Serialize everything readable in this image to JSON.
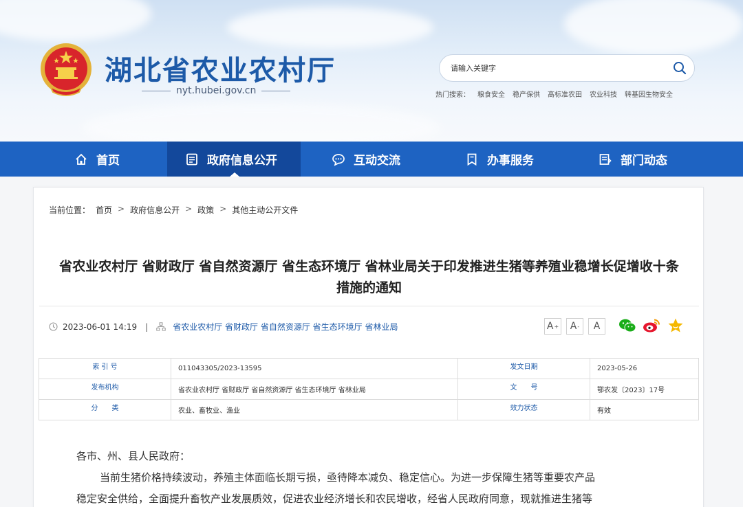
{
  "header": {
    "site_title": "湖北省农业农村厅",
    "site_domain": "nyt.hubei.gov.cn",
    "search": {
      "placeholder": "请输入关键字"
    },
    "hot_label": "热门搜索：",
    "hot_links": [
      "粮食安全",
      "稳产保供",
      "高标准农田",
      "农业科技",
      "转基因生物安全"
    ]
  },
  "nav": {
    "items": [
      {
        "label": "首页",
        "icon": "home-icon"
      },
      {
        "label": "政府信息公开",
        "icon": "document-icon",
        "active": true
      },
      {
        "label": "互动交流",
        "icon": "chat-icon"
      },
      {
        "label": "办事服务",
        "icon": "bookmark-icon"
      },
      {
        "label": "部门动态",
        "icon": "news-icon"
      }
    ]
  },
  "breadcrumb": {
    "label": "当前位置：",
    "items": [
      "首页",
      "政府信息公开",
      "政策",
      "其他主动公开文件"
    ],
    "separator": ">"
  },
  "article": {
    "title_line1": "省农业农村厅 省财政厅 省自然资源厅 省生态环境厅 省林业局关于印发推进生猪等养殖业稳增长促增收十条",
    "title_line2": "措施的通知",
    "datetime": "2023-06-01 14:19",
    "pipe": "|",
    "publisher": "省农业农村厅 省财政厅 省自然资源厅 省生态环境厅 省林业局",
    "font_buttons": [
      "A",
      "A",
      "A"
    ],
    "font_button_marks": [
      "+",
      "-"
    ],
    "share_icons": [
      "wechat-icon",
      "weibo-icon",
      "favorite-star-icon"
    ]
  },
  "info_table": {
    "rows": [
      {
        "k1": "索 引 号",
        "v1": "011043305/2023-13595",
        "k2": "发文日期",
        "v2": "2023-05-26"
      },
      {
        "k1": "发布机构",
        "v1": "省农业农村厅 省财政厅 省自然资源厅 省生态环境厅 省林业局",
        "k2": "文　　号",
        "v2": "鄂农发〔2023〕17号"
      },
      {
        "k1": "分　　类",
        "v1": "农业、畜牧业、渔业",
        "k2": "效力状态",
        "v2": "有效"
      }
    ]
  },
  "body": {
    "salutation": "各市、州、县人民政府：",
    "para1_line1": "当前生猪价格持续波动，养殖主体面临长期亏损，亟待降本减负、稳定信心。为进一步保障生猪等重要农产品",
    "para1_line2": "稳定安全供给，全面提升畜牧产业发展质效，促进农业经济增长和农民增收，经省人民政府同意，现就推进生猪等"
  },
  "colors": {
    "nav_bg": "#1e63c2",
    "nav_active": "#13489b",
    "brand_blue": "#1d5aa8",
    "weibo": "#e6162d",
    "wechat": "#1aad19",
    "star": "#f5b800"
  }
}
